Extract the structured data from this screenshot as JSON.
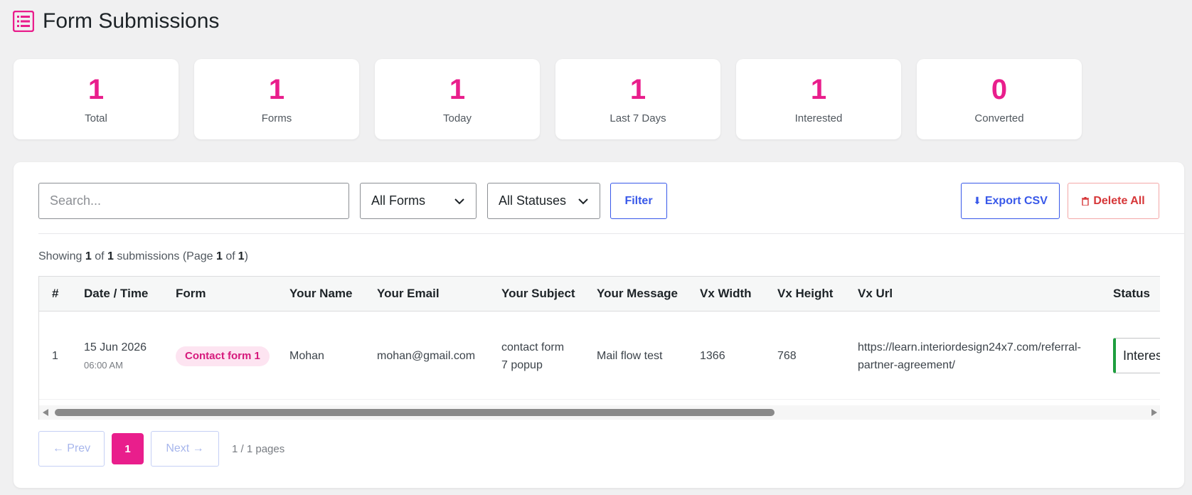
{
  "header": {
    "title": "Form Submissions",
    "icon": "list-icon",
    "accent": "#e91e8c"
  },
  "stats": [
    {
      "value": "1",
      "label": "Total"
    },
    {
      "value": "1",
      "label": "Forms"
    },
    {
      "value": "1",
      "label": "Today"
    },
    {
      "value": "1",
      "label": "Last 7 Days"
    },
    {
      "value": "1",
      "label": "Interested"
    },
    {
      "value": "0",
      "label": "Converted"
    }
  ],
  "toolbar": {
    "search_placeholder": "Search...",
    "search_value": "",
    "forms_select": "All Forms",
    "status_select": "All Statuses",
    "filter_label": "Filter",
    "export_label": "Export CSV",
    "export_icon": "download-icon",
    "delete_label": "Delete All",
    "delete_icon": "trash-icon"
  },
  "summary": {
    "prefix": "Showing",
    "count": "1",
    "of": "of",
    "total": "1",
    "suffix": "submissions (Page",
    "page": "1",
    "page_of": "of",
    "pages": "1",
    "close": ")"
  },
  "table": {
    "columns": [
      "#",
      "Date / Time",
      "Form",
      "Your Name",
      "Your Email",
      "Your Subject",
      "Your Message",
      "Vx Width",
      "Vx Height",
      "Vx Url",
      "Status"
    ],
    "rows": [
      {
        "num": "1",
        "date": "15 Jun 2026",
        "time": "06:00 AM",
        "form": "Contact form 1",
        "name": "Mohan",
        "email": "mohan@gmail.com",
        "subject_line1": "contact form",
        "subject_line2": "7 popup",
        "message": "Mail flow test",
        "vx_width": "1366",
        "vx_height": "768",
        "vx_url_line1": "https://learn.interiordesign24x7.com/referral-",
        "vx_url_line2": "partner-agreement/",
        "status": "Interested",
        "status_color": "#1e9e3e"
      }
    ],
    "scroll_fraction": 0.66
  },
  "pagination": {
    "prev": "← Prev",
    "current": "1",
    "next": "Next →",
    "info": "1 / 1 pages"
  }
}
